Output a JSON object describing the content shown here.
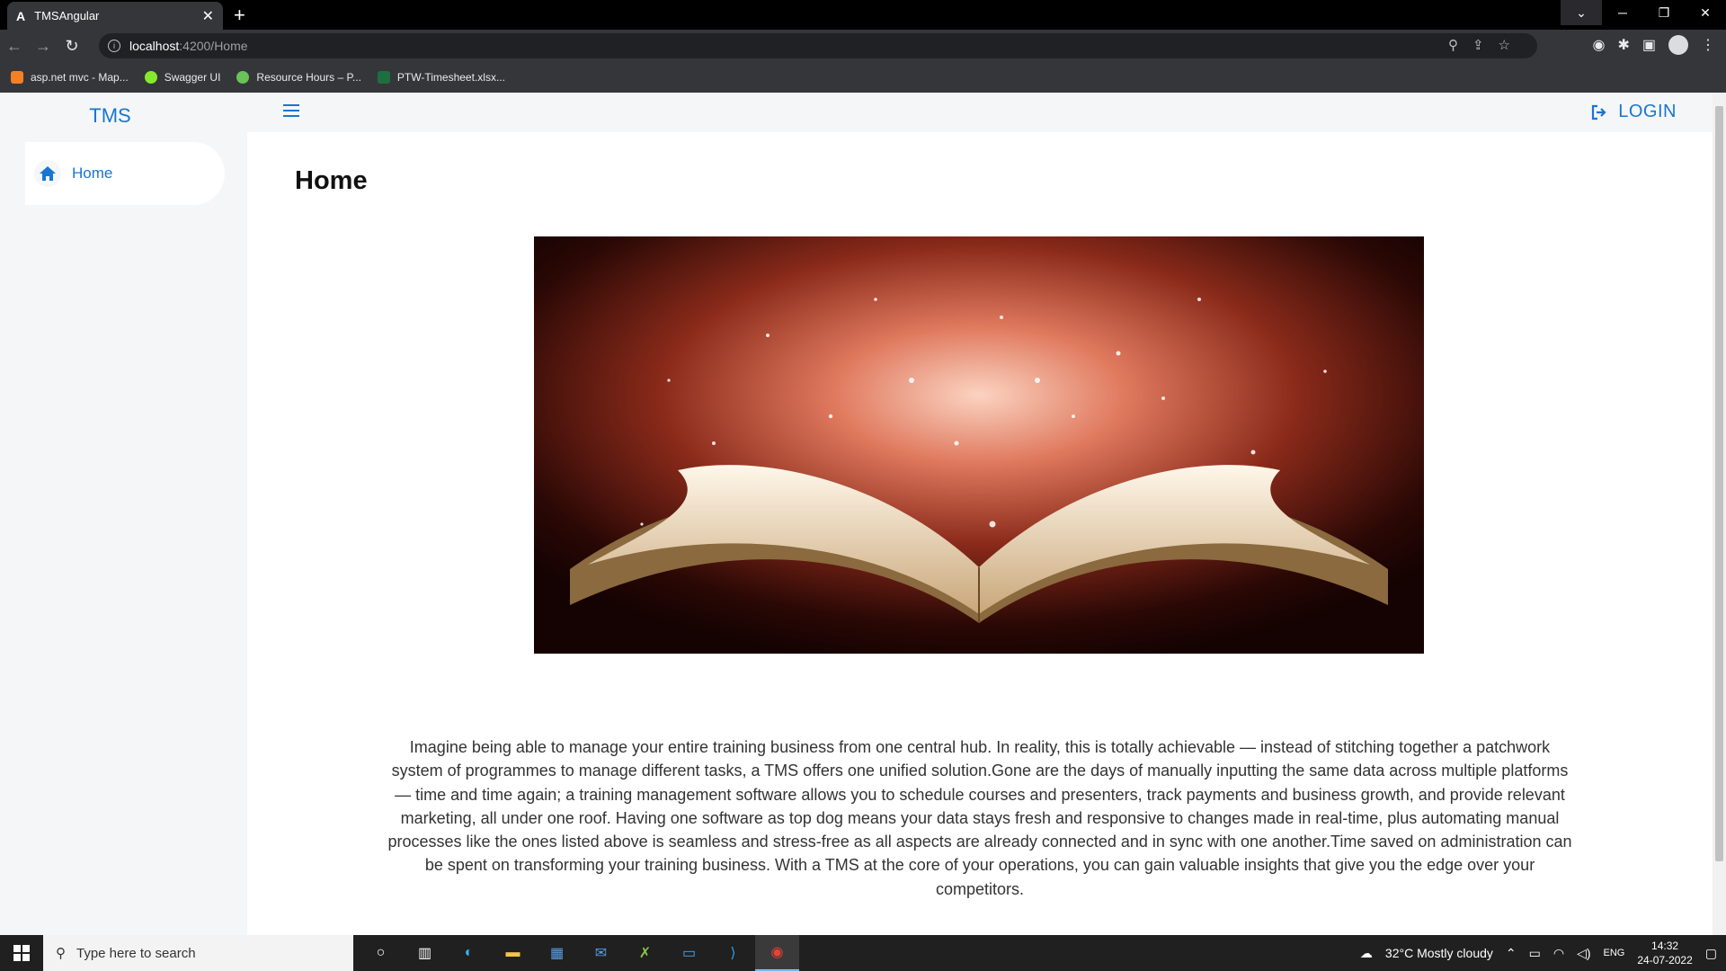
{
  "browser": {
    "tab_title": "TMSAngular",
    "tab_favicon": "A",
    "url_host": "localhost",
    "url_path": ":4200/Home",
    "bookmarks": [
      {
        "label": "asp.net mvc - Map...",
        "color": "#f48024"
      },
      {
        "label": "Swagger UI",
        "color": "#85ea2d"
      },
      {
        "label": "Resource Hours – P...",
        "color": "#6ac259"
      },
      {
        "label": "PTW-Timesheet.xlsx...",
        "color": "#1d6f42"
      }
    ]
  },
  "app": {
    "brand": "TMS",
    "sidebar": {
      "items": [
        {
          "label": "Home",
          "icon": "home-icon"
        }
      ]
    },
    "header": {
      "login_label": "LOGIN"
    },
    "page_title": "Home",
    "hero_image": "open-book-sparkles",
    "description": "Imagine being able to manage your entire training business from one central hub. In reality, this is totally achievable — instead of stitching together a patchwork system of programmes to manage different tasks, a TMS offers one unified solution.Gone are the days of manually inputting the same data across multiple platforms — time and time again; a training management software allows you to schedule courses and presenters, track payments and business growth, and provide relevant marketing, all under one roof. Having one software as top dog means your data stays fresh and responsive to changes made in real-time, plus automating manual processes like the ones listed above is seamless and stress-free as all aspects are already connected and in sync with one another.Time saved on administration can be spent on transforming your training business. With a TMS at the core of your operations, you can gain valuable insights that give you the edge over your competitors.",
    "accent_color": "#1976d2"
  },
  "taskbar": {
    "search_placeholder": "Type here to search",
    "weather": "32°C  Mostly cloudy",
    "lang": "ENG",
    "time": "14:32",
    "date": "24-07-2022"
  }
}
